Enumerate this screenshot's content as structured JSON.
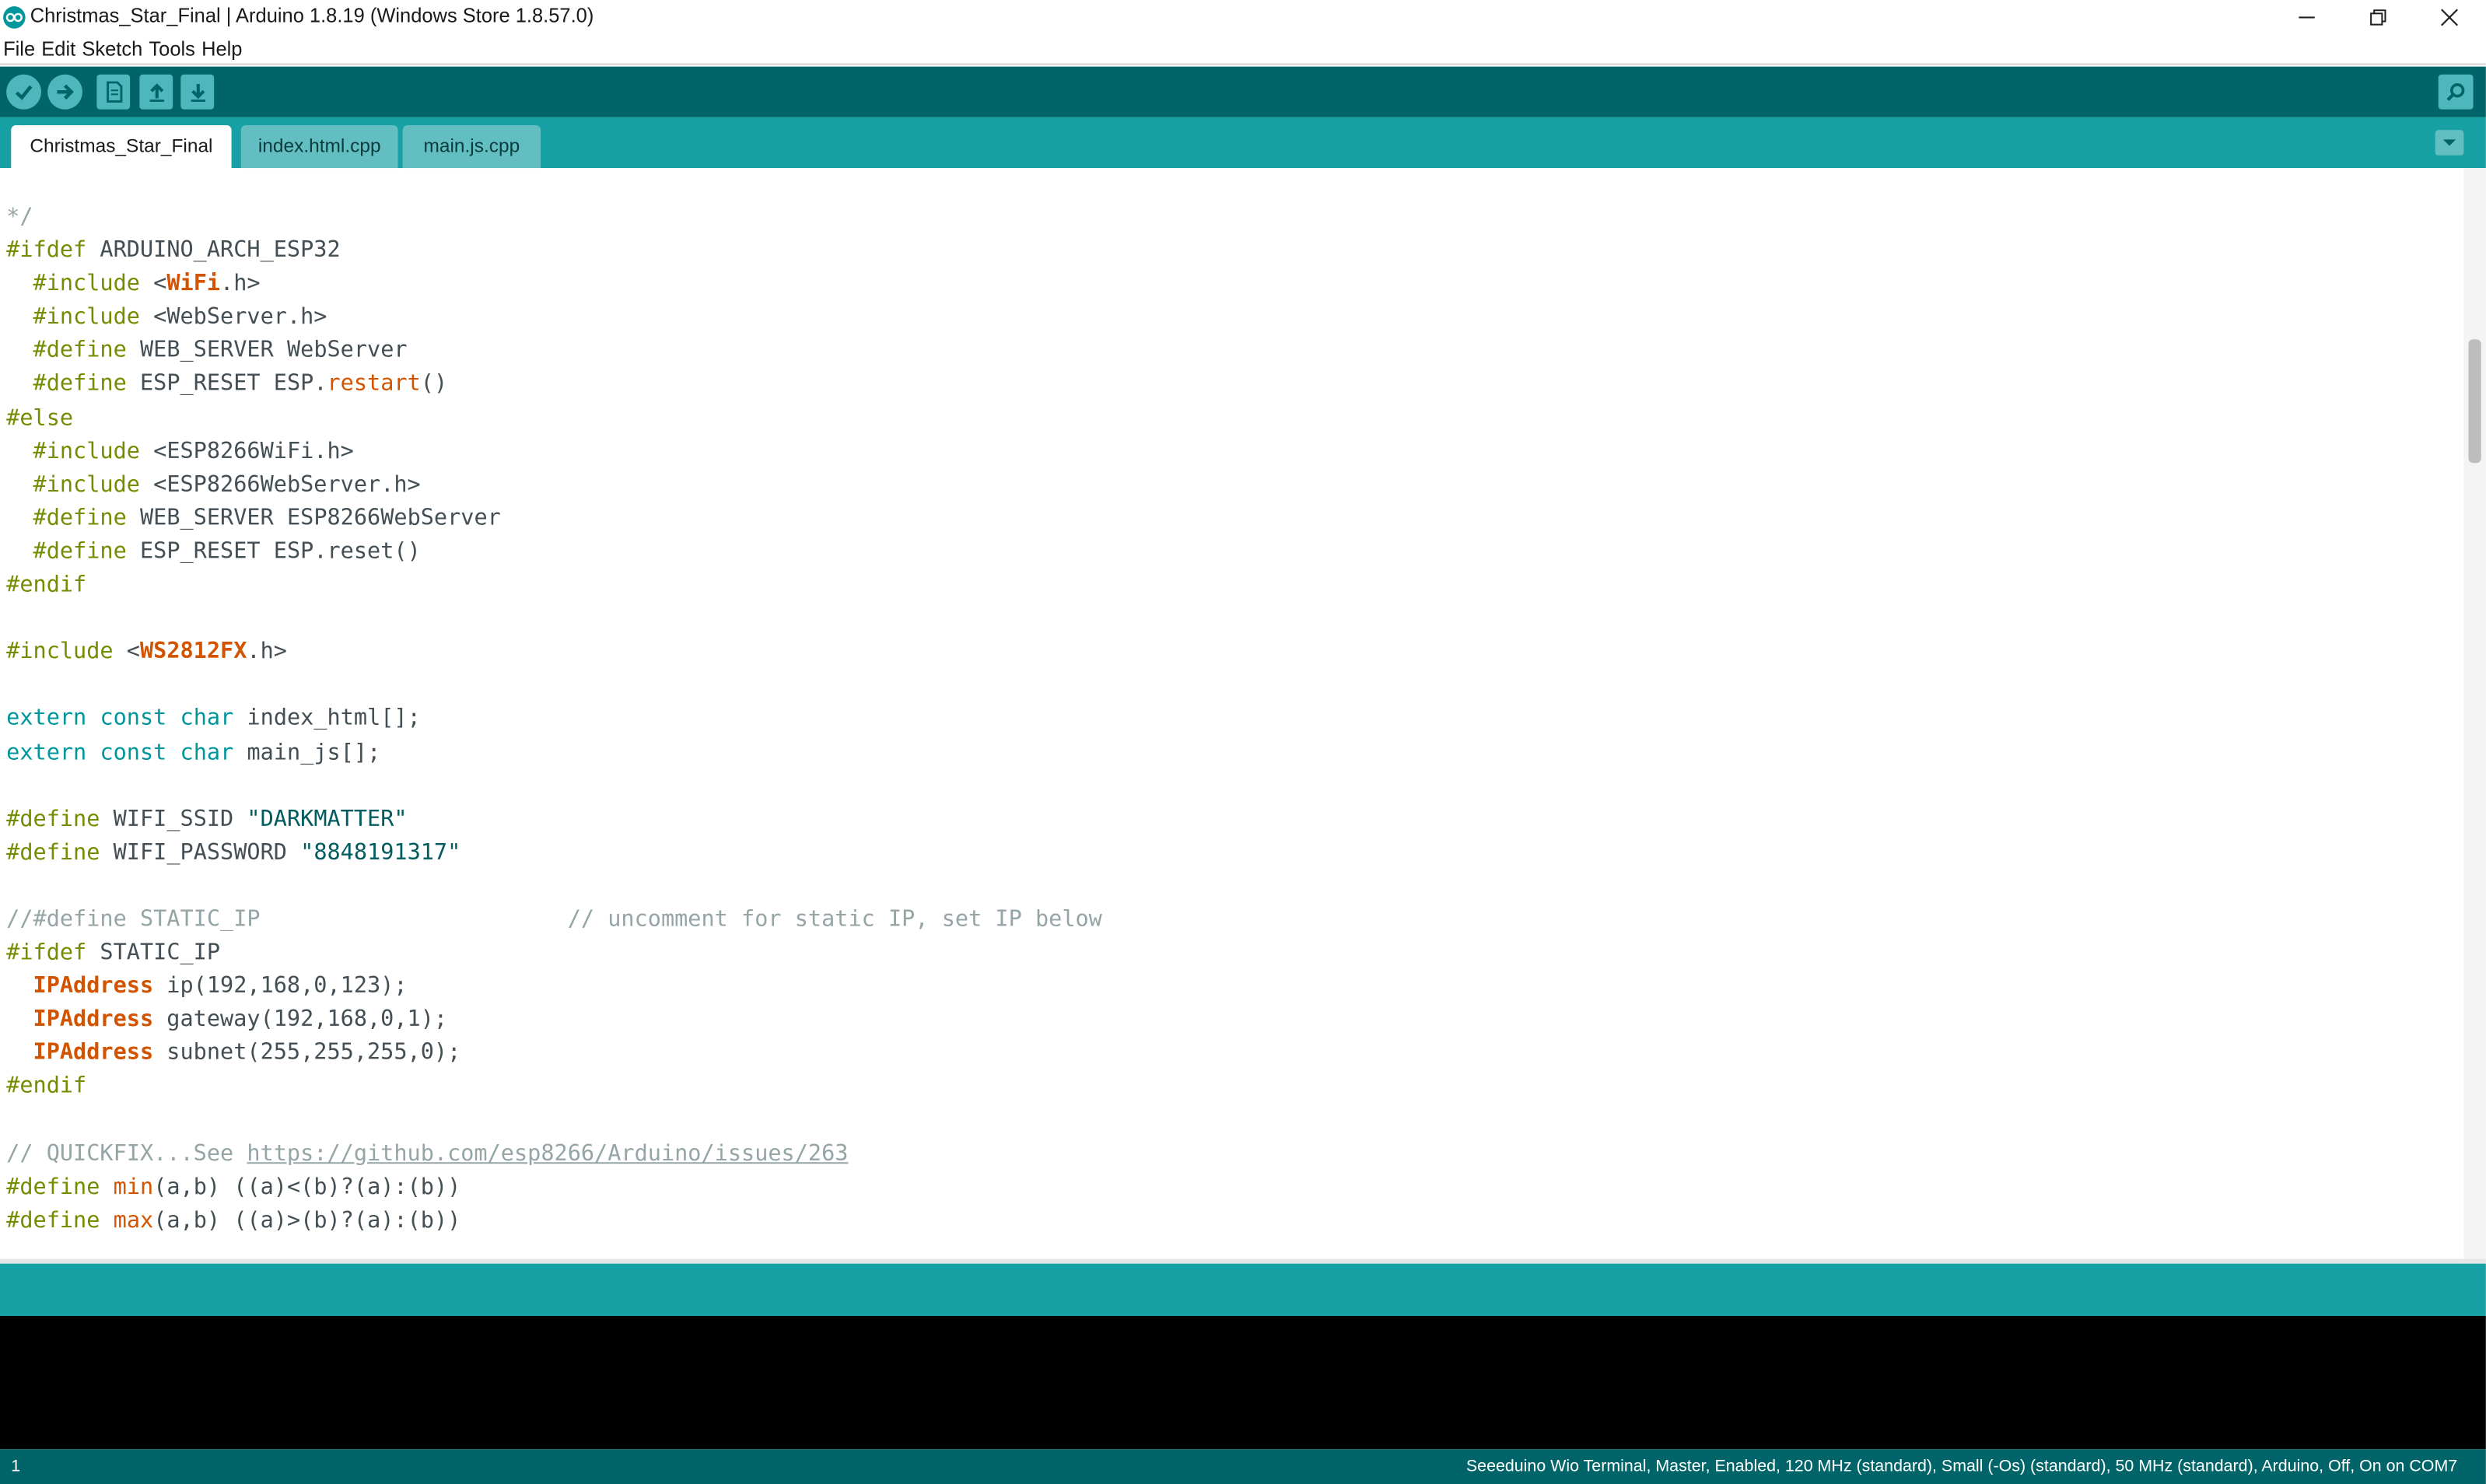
{
  "window": {
    "title": "Christmas_Star_Final | Arduino 1.8.19 (Windows Store 1.8.57.0)",
    "logo_icon": "arduino-logo-icon",
    "controls": [
      "minimize-icon",
      "maximize-icon",
      "close-icon"
    ]
  },
  "menu": [
    "File",
    "Edit",
    "Sketch",
    "Tools",
    "Help"
  ],
  "toolbar": {
    "buttons": [
      "check-icon",
      "arrow-right-icon",
      "document-icon",
      "arrow-up-icon",
      "arrow-down-icon"
    ],
    "right_button": "magnifier-icon"
  },
  "tabs": [
    {
      "label": "Christmas_Star_Final",
      "active": true
    },
    {
      "label": "index.html.cpp",
      "active": false
    },
    {
      "label": "main.js.cpp",
      "active": false
    }
  ],
  "editor": {
    "lines": [
      [
        {
          "t": "*/",
          "c": "cm"
        }
      ],
      [
        {
          "t": "#ifdef",
          "c": "pp"
        },
        {
          "t": " ARDUINO_ARCH_ESP32",
          "c": ""
        }
      ],
      [
        {
          "t": "  ",
          "c": ""
        },
        {
          "t": "#include",
          "c": "pp"
        },
        {
          "t": " <",
          "c": ""
        },
        {
          "t": "WiFi",
          "c": "lib"
        },
        {
          "t": ".h>",
          "c": ""
        }
      ],
      [
        {
          "t": "  ",
          "c": ""
        },
        {
          "t": "#include",
          "c": "pp"
        },
        {
          "t": " <WebServer.h>",
          "c": ""
        }
      ],
      [
        {
          "t": "  ",
          "c": ""
        },
        {
          "t": "#define",
          "c": "pp"
        },
        {
          "t": " WEB_SERVER WebServer",
          "c": ""
        }
      ],
      [
        {
          "t": "  ",
          "c": ""
        },
        {
          "t": "#define",
          "c": "pp"
        },
        {
          "t": " ESP_RESET ESP.",
          "c": ""
        },
        {
          "t": "restart",
          "c": "fn"
        },
        {
          "t": "()",
          "c": ""
        }
      ],
      [
        {
          "t": "#else",
          "c": "pp"
        }
      ],
      [
        {
          "t": "  ",
          "c": ""
        },
        {
          "t": "#include",
          "c": "pp"
        },
        {
          "t": " <ESP8266WiFi.h>",
          "c": ""
        }
      ],
      [
        {
          "t": "  ",
          "c": ""
        },
        {
          "t": "#include",
          "c": "pp"
        },
        {
          "t": " <ESP8266WebServer.h>",
          "c": ""
        }
      ],
      [
        {
          "t": "  ",
          "c": ""
        },
        {
          "t": "#define",
          "c": "pp"
        },
        {
          "t": " WEB_SERVER ESP8266WebServer",
          "c": ""
        }
      ],
      [
        {
          "t": "  ",
          "c": ""
        },
        {
          "t": "#define",
          "c": "pp"
        },
        {
          "t": " ESP_RESET ESP.reset()",
          "c": ""
        }
      ],
      [
        {
          "t": "#endif",
          "c": "pp"
        }
      ],
      [],
      [
        {
          "t": "#include",
          "c": "pp"
        },
        {
          "t": " <",
          "c": ""
        },
        {
          "t": "WS2812FX",
          "c": "lib"
        },
        {
          "t": ".h>",
          "c": ""
        }
      ],
      [],
      [
        {
          "t": "extern",
          "c": "kw"
        },
        {
          "t": " ",
          "c": ""
        },
        {
          "t": "const",
          "c": "kw"
        },
        {
          "t": " ",
          "c": ""
        },
        {
          "t": "char",
          "c": "kw"
        },
        {
          "t": " index_html[];",
          "c": ""
        }
      ],
      [
        {
          "t": "extern",
          "c": "kw"
        },
        {
          "t": " ",
          "c": ""
        },
        {
          "t": "const",
          "c": "kw"
        },
        {
          "t": " ",
          "c": ""
        },
        {
          "t": "char",
          "c": "kw"
        },
        {
          "t": " main_js[];",
          "c": ""
        }
      ],
      [],
      [
        {
          "t": "#define",
          "c": "pp"
        },
        {
          "t": " WIFI_SSID ",
          "c": ""
        },
        {
          "t": "\"DARKMATTER\"",
          "c": "str"
        }
      ],
      [
        {
          "t": "#define",
          "c": "pp"
        },
        {
          "t": " WIFI_PASSWORD ",
          "c": ""
        },
        {
          "t": "\"8848191317\"",
          "c": "str"
        }
      ],
      [],
      [
        {
          "t": "//#define STATIC_IP                       // uncomment for static IP, set IP below",
          "c": "cm"
        }
      ],
      [
        {
          "t": "#ifdef",
          "c": "pp"
        },
        {
          "t": " STATIC_IP",
          "c": ""
        }
      ],
      [
        {
          "t": "  ",
          "c": ""
        },
        {
          "t": "IPAddress",
          "c": "lib"
        },
        {
          "t": " ip(192,168,0,123);",
          "c": ""
        }
      ],
      [
        {
          "t": "  ",
          "c": ""
        },
        {
          "t": "IPAddress",
          "c": "lib"
        },
        {
          "t": " gateway(192,168,0,1);",
          "c": ""
        }
      ],
      [
        {
          "t": "  ",
          "c": ""
        },
        {
          "t": "IPAddress",
          "c": "lib"
        },
        {
          "t": " subnet(255,255,255,0);",
          "c": ""
        }
      ],
      [
        {
          "t": "#endif",
          "c": "pp"
        }
      ],
      [],
      [
        {
          "t": "// QUICKFIX...See ",
          "c": "cm"
        },
        {
          "t": "https://github.com/esp8266/Arduino/issues/263",
          "c": "url"
        }
      ],
      [
        {
          "t": "#define",
          "c": "pp"
        },
        {
          "t": " ",
          "c": ""
        },
        {
          "t": "min",
          "c": "fn"
        },
        {
          "t": "(a,b) ((a)<(b)?(a):(b))",
          "c": ""
        }
      ],
      [
        {
          "t": "#define",
          "c": "pp"
        },
        {
          "t": " ",
          "c": ""
        },
        {
          "t": "max",
          "c": "fn"
        },
        {
          "t": "(a,b) ((a)>(b)?(a):(b))",
          "c": ""
        }
      ]
    ]
  },
  "status": {
    "line_number": "1",
    "board_info": "Seeeduino Wio Terminal, Master, Enabled, 120 MHz (standard), Small (-Os) (standard), 50 MHz (standard), Arduino, Off, On on COM7"
  },
  "colors": {
    "toolbar": "#006468",
    "tabbar": "#17a1a5",
    "preprocessor": "#728e00",
    "keyword": "#00979c",
    "library": "#d35400",
    "string": "#005c5f",
    "comment": "#95a5a6"
  }
}
